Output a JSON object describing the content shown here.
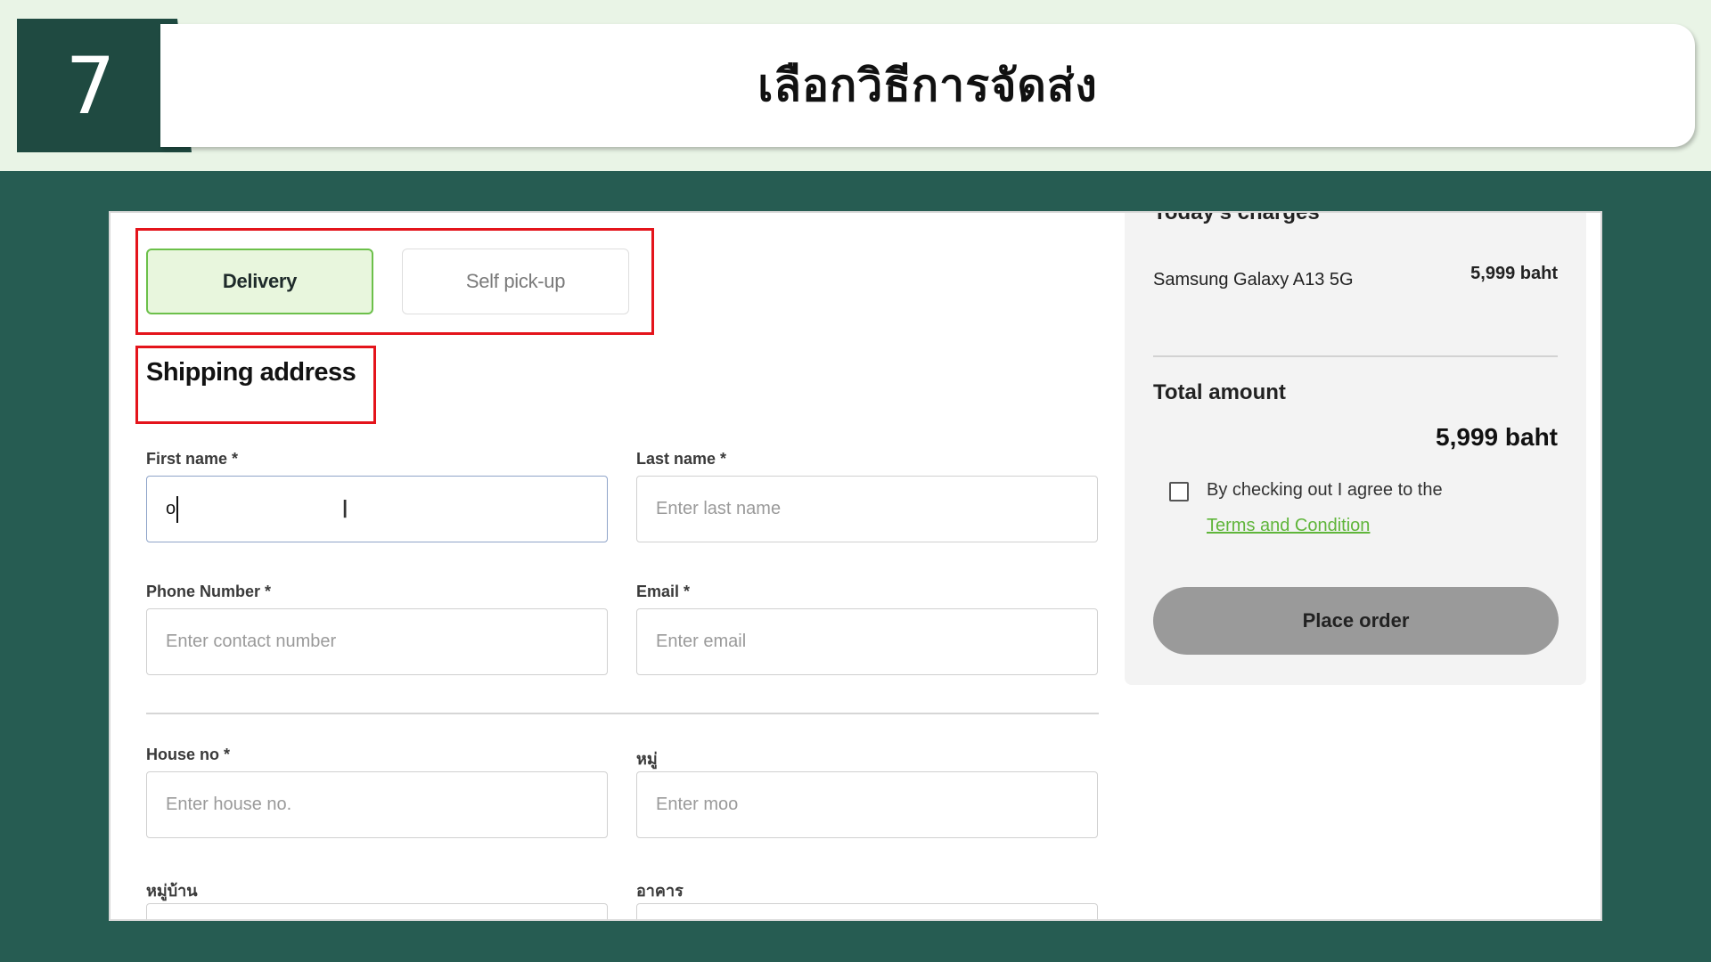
{
  "banner": {
    "step_number": "7",
    "title": "เลือกวิธีการจัดส่ง"
  },
  "delivery_methods": {
    "delivery_label": "Delivery",
    "pickup_label": "Self pick-up",
    "selected": "Delivery"
  },
  "shipping": {
    "section_title": "Shipping address",
    "first_name": {
      "label": "First name *",
      "value": "o"
    },
    "last_name": {
      "label": "Last name *",
      "placeholder": "Enter last name"
    },
    "phone": {
      "label": "Phone Number *",
      "placeholder": "Enter contact number"
    },
    "email": {
      "label": "Email *",
      "placeholder": "Enter email"
    },
    "house_no": {
      "label": "House no *",
      "placeholder": "Enter house no."
    },
    "moo": {
      "label": "หมู่",
      "placeholder": "Enter moo"
    },
    "village": {
      "label": "หมู่บ้าน"
    },
    "building": {
      "label": "อาคาร"
    }
  },
  "summary": {
    "section_title": "Today's charges",
    "item_name": "Samsung Galaxy A13 5G",
    "item_price": "5,999 baht",
    "total_label": "Total amount",
    "total_value": "5,999 baht",
    "agree_text": "By checking out I agree to the",
    "terms_link": "Terms and Condition",
    "place_order": "Place order"
  },
  "colors": {
    "background": "#265c52",
    "banner": "#e9f4e6",
    "accent_green": "#6cc04a",
    "highlight_red": "#e4141b"
  }
}
